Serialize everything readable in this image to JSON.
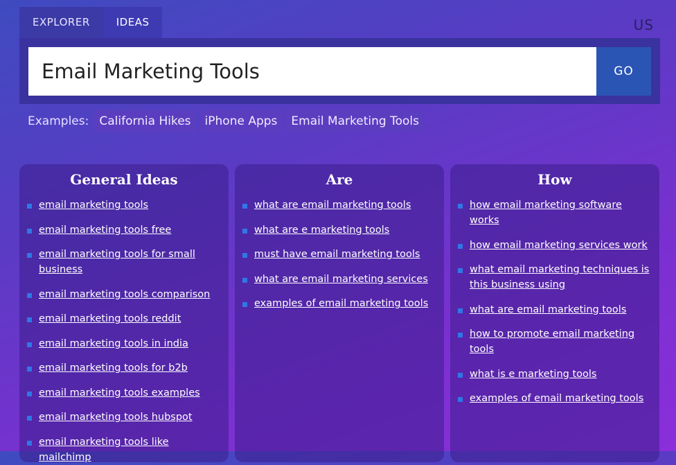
{
  "tabs": [
    {
      "label": "EXPLORER"
    },
    {
      "label": "IDEAS"
    }
  ],
  "country": "US",
  "search": {
    "value": "Email Marketing Tools",
    "go_label": "GO"
  },
  "examples": {
    "label": "Examples:",
    "chips": [
      "California Hikes",
      "iPhone Apps",
      "Email Marketing Tools"
    ]
  },
  "panels": [
    {
      "title": "General Ideas",
      "items": [
        "email marketing tools",
        "email marketing tools free",
        "email marketing tools for small business",
        "email marketing tools comparison",
        "email marketing tools reddit",
        "email marketing tools in india",
        "email marketing tools for b2b",
        "email marketing tools examples",
        "email marketing tools hubspot",
        "email marketing tools like mailchimp"
      ]
    },
    {
      "title": "Are",
      "items": [
        "what are email marketing tools",
        "what are e marketing tools",
        "must have email marketing tools",
        "what are email marketing services",
        "examples of email marketing tools"
      ]
    },
    {
      "title": "How",
      "items": [
        "how email marketing software works",
        "how email marketing services work",
        "what email marketing techniques is this business using",
        "what are email marketing tools",
        "how to promote email marketing tools",
        "what is e marketing tools",
        "examples of email marketing tools"
      ]
    }
  ]
}
